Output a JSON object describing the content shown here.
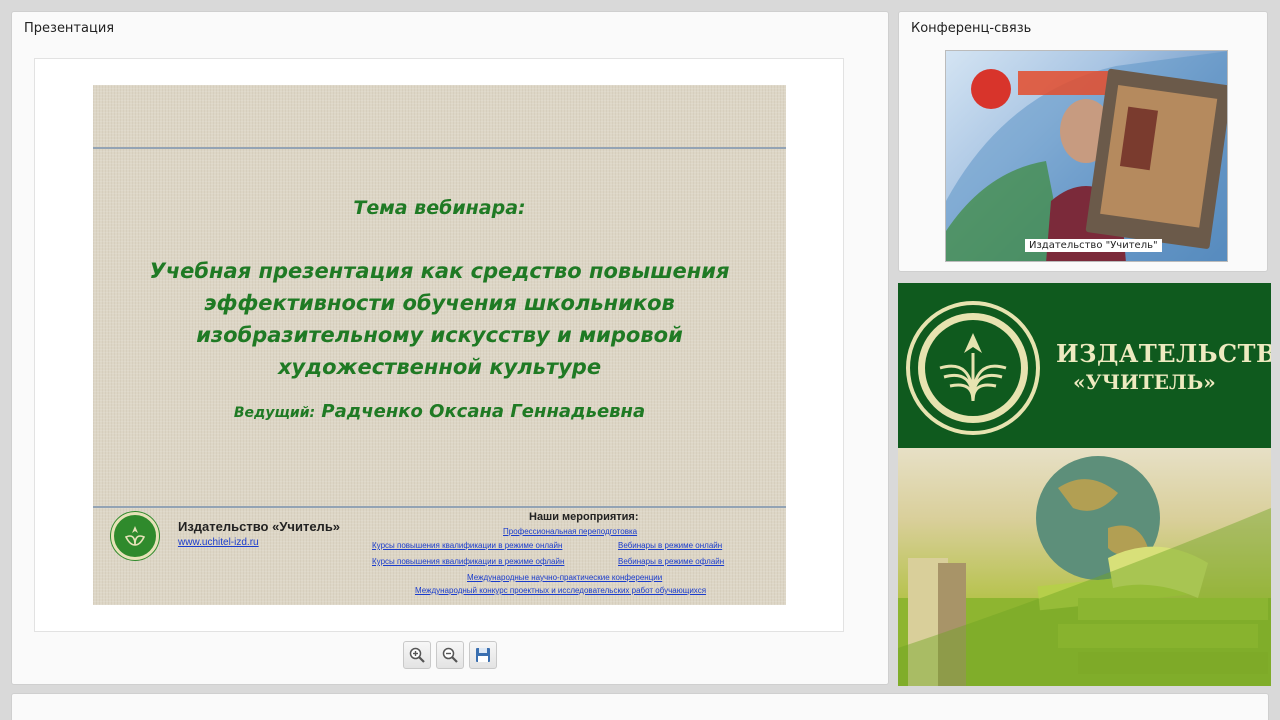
{
  "presentation": {
    "title": "Презентация",
    "slide": {
      "subtitle": "Тема вебинара:",
      "title": "Учебная презентация как средство повышения эффективности обучения школьников изобразительному искусству и мировой художественной культуре",
      "presenter_label": "Ведущий:",
      "presenter_name": "Радченко Оксана Геннадьевна",
      "publisher": "Издательство «Учитель»",
      "site": "www.uchitel-izd.ru",
      "events_title": "Наши мероприятия:",
      "events": [
        "Профессиональная переподготовка",
        "Курсы повышения квалификации в режиме онлайн",
        "Вебинары в режиме онлайн",
        "Курсы повышения квалификации в режиме офлайн",
        "Вебинары в режиме офлайн",
        "Международные научно-практические конференции",
        "Международный конкурс проектных и исследовательских работ обучающихся"
      ]
    },
    "tools": [
      "zoom-in-icon",
      "zoom-out-icon",
      "save-icon"
    ]
  },
  "conference": {
    "title": "Конференц-связь",
    "video_caption": "Издательство \"Учитель\""
  },
  "banner": {
    "name_line1": "ИЗДАТЕЛЬСТВО",
    "name_line2": "«УЧИТЕЛЬ»"
  },
  "colors": {
    "slide_text": "#1f7a24",
    "banner_green": "#0f5a1e",
    "banner_text": "#eeeac0",
    "link": "#1a3ccc"
  }
}
